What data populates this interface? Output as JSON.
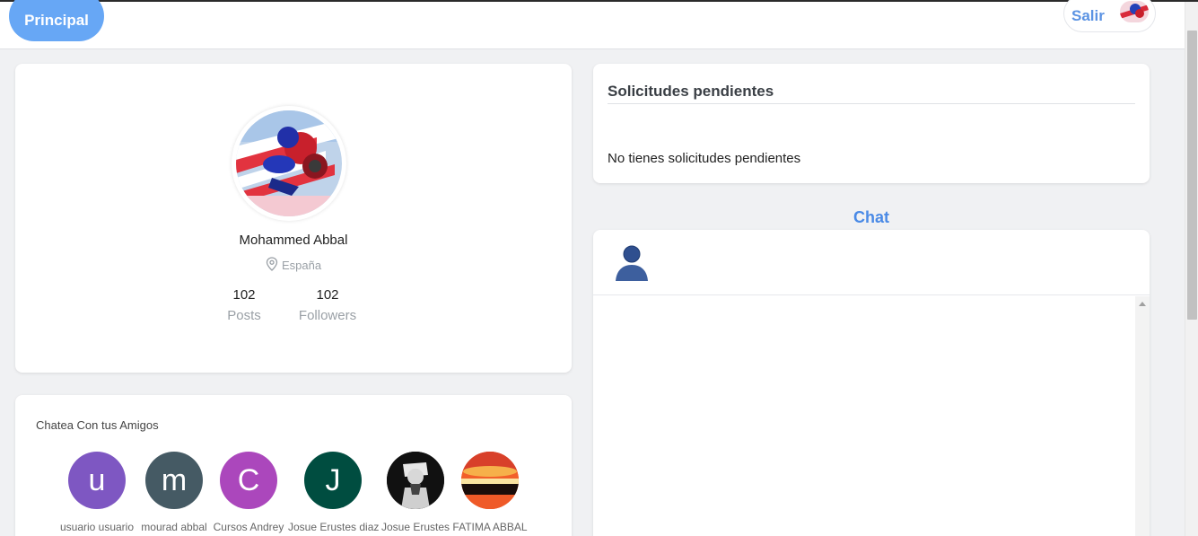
{
  "navbar": {
    "home_label": "Principal",
    "logout_label": "Salir"
  },
  "profile": {
    "name": "Mohammed Abbal",
    "location": "España",
    "stats": {
      "posts_count": "102",
      "posts_label": "Posts",
      "followers_count": "102",
      "followers_label": "Followers"
    }
  },
  "friends": {
    "title": "Chatea Con tus Amigos",
    "items": [
      {
        "initial": "u",
        "name": "usuario usuario",
        "color": "#7e57c2"
      },
      {
        "initial": "m",
        "name": "mourad abbal",
        "color": "#455a64"
      },
      {
        "initial": "C",
        "name": "Cursos Andrey",
        "color": "#ab47bc"
      },
      {
        "initial": "J",
        "name": "Josue Erustes diaz",
        "color": "#004d40"
      },
      {
        "initial": "",
        "name": "Josue Erustes",
        "color": "#111111"
      },
      {
        "initial": "",
        "name": "FATIMA ABBAL",
        "color": "#e64a19"
      }
    ]
  },
  "pending": {
    "title": "Solicitudes pendientes",
    "empty_message": "No tienes solicitudes pendientes"
  },
  "chat": {
    "heading": "Chat"
  },
  "colors": {
    "accent": "#67a7f5",
    "link_blue": "#4a8ae6",
    "background": "#f0f1f3"
  }
}
